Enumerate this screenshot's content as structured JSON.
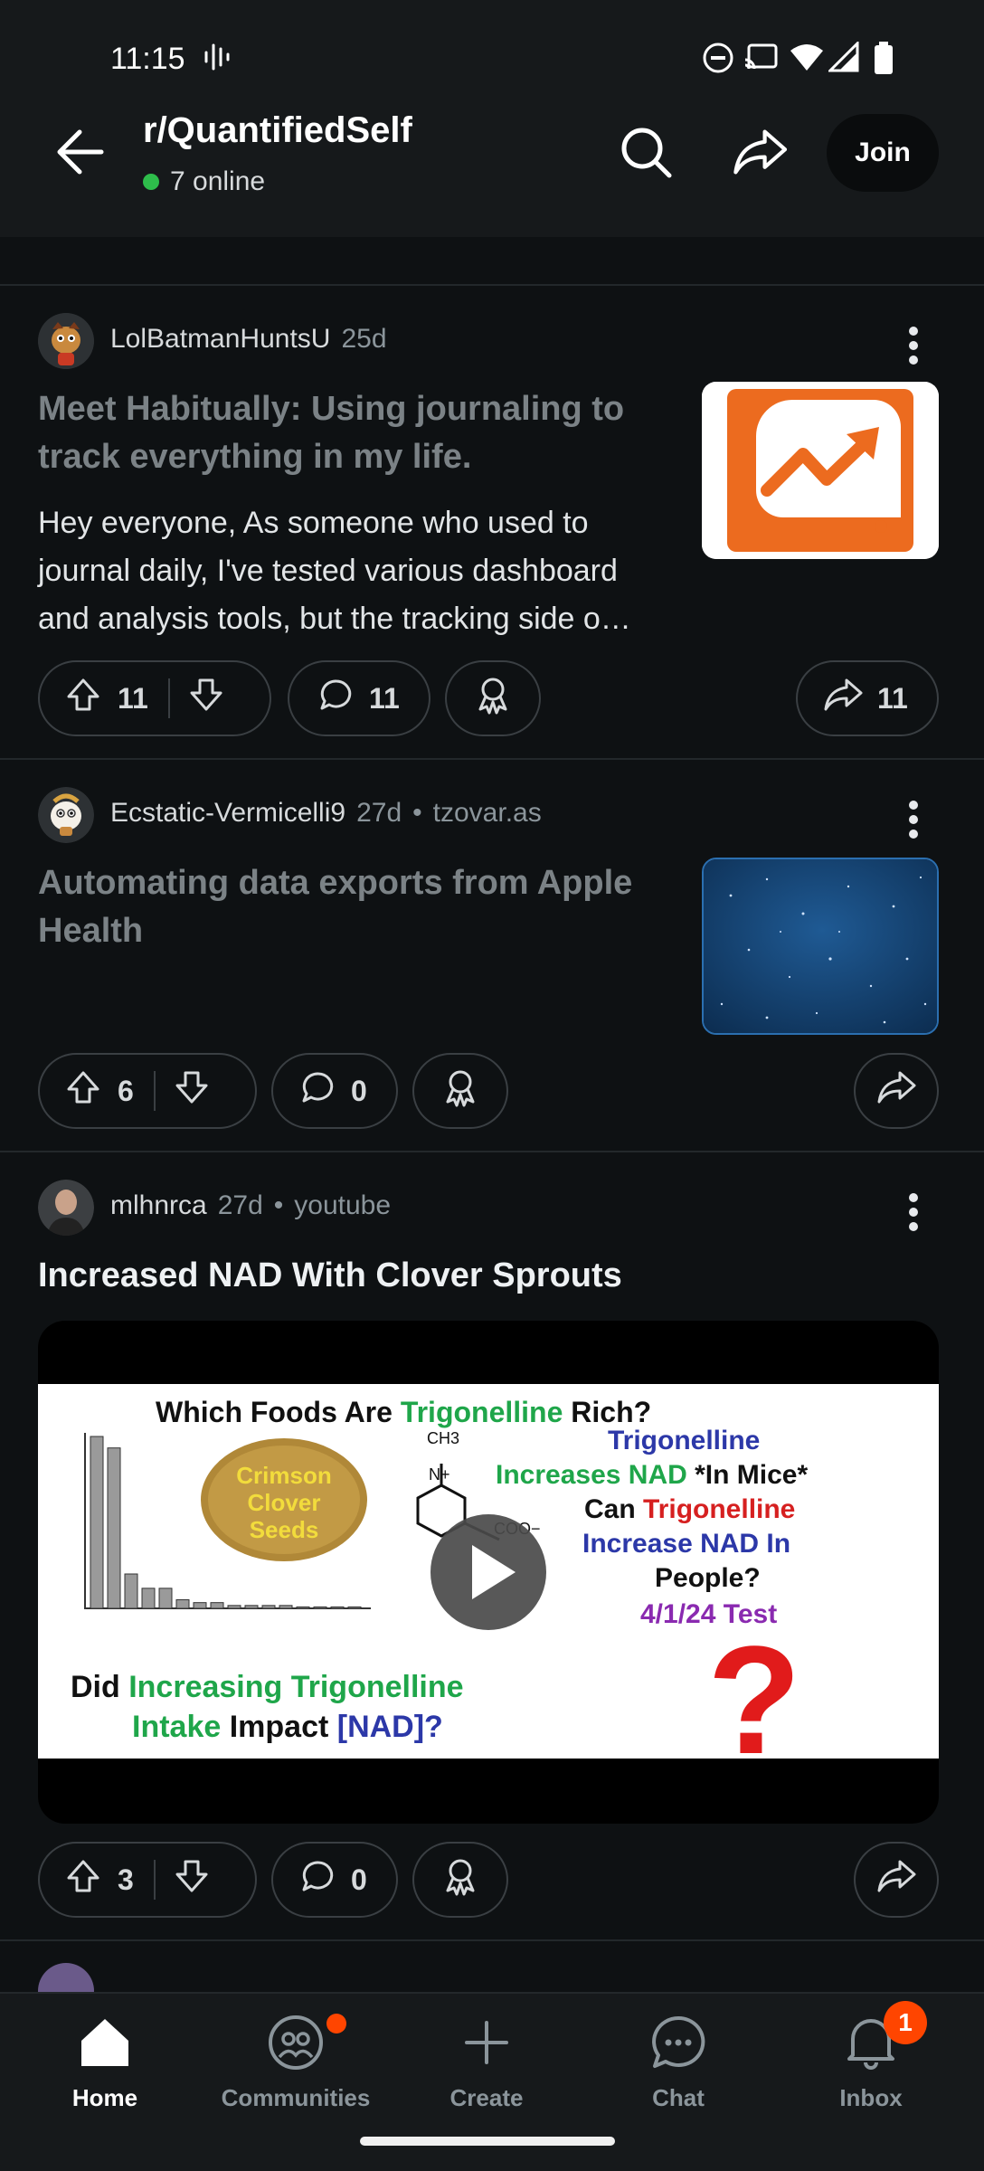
{
  "status_bar": {
    "time": "11:15"
  },
  "header": {
    "subreddit": "r/QuantifiedSelf",
    "online": "7 online",
    "join_label": "Join"
  },
  "posts": [
    {
      "author": "LolBatmanHuntsU",
      "age": "25d",
      "title": "Meet Habitually: Using journaling to track everything in my life.",
      "body": "Hey everyone, As someone who used to journal daily, I've tested various dashboard and analysis tools, but the tracking side o…",
      "upvotes": "11",
      "comments": "11",
      "shares": "11"
    },
    {
      "author": "Ecstatic-Vermicelli9",
      "age": "27d",
      "domain": "tzovar.as",
      "title": "Automating data exports from Apple Health",
      "upvotes": "6",
      "comments": "0"
    },
    {
      "author": "mlhnrca",
      "age": "27d",
      "domain": "youtube",
      "title": "Increased NAD With Clover Sprouts",
      "video": {
        "heading_a": "Which Foods Are ",
        "heading_b": "Trigonelline",
        "heading_c": " Rich?",
        "seeds_1": "Crimson",
        "seeds_2": "Clover",
        "seeds_3": "Seeds",
        "mol_top": "CH3",
        "mol_n": "N+",
        "mol_coo": "COO−",
        "right_1": "Trigonelline",
        "right_2a": "Increases NAD ",
        "right_2b": "*In Mice*",
        "right_3a": "Can ",
        "right_3b": "Trigonelline",
        "right_4": "Increase NAD In",
        "right_5": "People?",
        "right_6": "4/1/24 Test",
        "bottom_1a": "Did ",
        "bottom_1b": "Increasing Trigonelline",
        "bottom_2a": "Intake",
        "bottom_2b": " Impact ",
        "bottom_2c": "[NAD]?",
        "qmark": "?",
        "chart_values": [
          60,
          56,
          12,
          7,
          7,
          3,
          2,
          2,
          1,
          1,
          1,
          1,
          0.5,
          0.5,
          0.5,
          0.5
        ]
      },
      "upvotes": "3",
      "comments": "0"
    }
  ],
  "nav": {
    "home": "Home",
    "communities": "Communities",
    "create": "Create",
    "chat": "Chat",
    "inbox": "Inbox",
    "inbox_badge": "1"
  },
  "colors": {
    "accent": "#ff4500",
    "online": "#2ebd4b",
    "background": "#0e1113"
  }
}
